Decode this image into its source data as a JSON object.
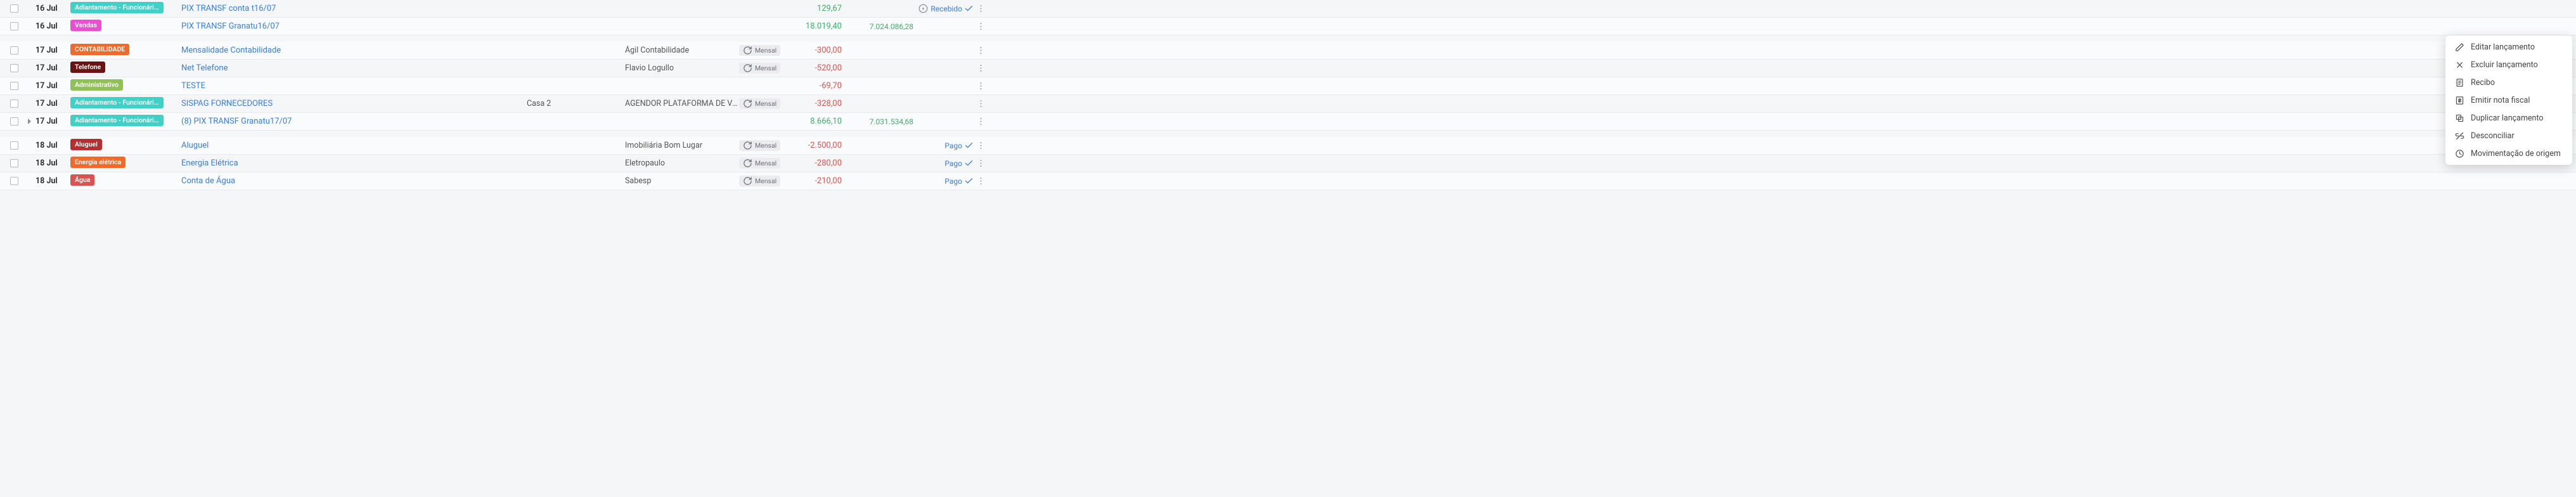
{
  "status_labels": {
    "recebido": "Recebido",
    "pago": "Pago"
  },
  "recur_label": "Mensal",
  "menu": {
    "edit": "Editar lançamento",
    "delete": "Excluir lançamento",
    "receipt": "Recibo",
    "invoice": "Emitir nota fiscal",
    "duplicate": "Duplicar lançamento",
    "unreconcile": "Desconciliar",
    "origin": "Movimentação de origem"
  },
  "rows": [
    {
      "date": "16 Jul",
      "tag": {
        "label": "Adiantamento - Funcionári…",
        "bg": "#3fd1c8"
      },
      "desc": "PIX TRANSF conta t16/07",
      "loc": "",
      "party": "",
      "recur": false,
      "amount": "129,67",
      "amount_cls": "amt-pos",
      "balance": "",
      "status": "recebido",
      "has_bolt": true
    },
    {
      "date": "16 Jul",
      "tag": {
        "label": "Vendas",
        "bg": "#e84fd1"
      },
      "desc": "PIX TRANSF Granatu16/07",
      "loc": "",
      "party": "",
      "recur": false,
      "amount": "18.019,40",
      "amount_cls": "amt-pos",
      "balance": "7.024.086,28",
      "status": "",
      "has_bolt": false,
      "has_menu": true
    },
    {
      "spacer": true
    },
    {
      "date": "17 Jul",
      "tag": {
        "label": "CONTABILIDADE",
        "bg": "#f26a2a"
      },
      "desc": "Mensalidade Contabilidade",
      "loc": "",
      "party": "Ágil Contabilidade",
      "recur": true,
      "amount": "-300,00",
      "amount_cls": "amt-neg",
      "balance": "",
      "status": ""
    },
    {
      "date": "17 Jul",
      "tag": {
        "label": "Telefone",
        "bg": "#6b1313"
      },
      "desc": "Net Telefone",
      "loc": "",
      "party": "Flavio Logullo",
      "recur": true,
      "amount": "-520,00",
      "amount_cls": "amt-neg",
      "balance": "",
      "status": ""
    },
    {
      "date": "17 Jul",
      "tag": {
        "label": "Administrativo",
        "bg": "#8fc155"
      },
      "desc": "TESTE",
      "loc": "",
      "party": "",
      "recur": false,
      "amount": "-69,70",
      "amount_cls": "amt-neg",
      "balance": "",
      "status": ""
    },
    {
      "date": "17 Jul",
      "tag": {
        "label": "Adiantamento - Funcionári…",
        "bg": "#3fd1c8"
      },
      "desc": "SISPAG FORNECEDORES",
      "loc": "Casa 2",
      "party": "AGENDOR PLATAFORMA DE VEND…",
      "recur": true,
      "amount": "-328,00",
      "amount_cls": "amt-neg",
      "balance": "",
      "status": ""
    },
    {
      "date": "17 Jul",
      "tag": {
        "label": "Adiantamento - Funcionári…",
        "bg": "#3fd1c8"
      },
      "desc": "(8) PIX TRANSF Granatu17/07",
      "loc": "",
      "party": "",
      "recur": false,
      "amount": "8.666,10",
      "amount_cls": "amt-pos",
      "balance": "7.031.534,68",
      "status": "",
      "expand": true
    },
    {
      "spacer": true
    },
    {
      "date": "18 Jul",
      "tag": {
        "label": "Aluguel",
        "bg": "#b52f2f"
      },
      "desc": "Aluguel",
      "loc": "",
      "party": "Imobiliária Bom Lugar",
      "recur": true,
      "amount": "-2.500,00",
      "amount_cls": "amt-neg",
      "balance": "",
      "status": "pago"
    },
    {
      "date": "18 Jul",
      "tag": {
        "label": "Energia elétrica",
        "bg": "#f26a2a"
      },
      "desc": "Energia Elétrica",
      "loc": "",
      "party": "Eletropaulo",
      "recur": true,
      "amount": "-280,00",
      "amount_cls": "amt-neg",
      "balance": "",
      "status": "pago",
      "group_first": true
    },
    {
      "date": "18 Jul",
      "tag": {
        "label": "Água",
        "bg": "#d9534f"
      },
      "desc": "Conta de Água",
      "loc": "",
      "party": "Sabesp",
      "recur": true,
      "amount": "-210,00",
      "amount_cls": "amt-neg",
      "balance": "",
      "status": "pago"
    }
  ]
}
